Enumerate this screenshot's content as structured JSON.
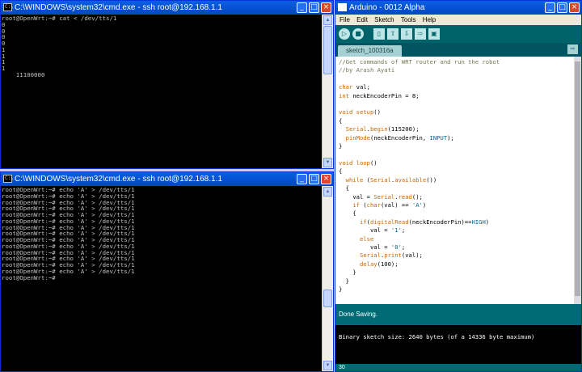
{
  "top_console": {
    "title": "C:\\WINDOWS\\system32\\cmd.exe - ssh root@192.168.1.1",
    "lines": [
      "root@OpenWrt:~# cat < /dev/tts/1",
      "0",
      "0",
      "0",
      "0",
      "1",
      "1",
      "1",
      "1",
      "    11100000"
    ]
  },
  "bottom_console": {
    "title": "C:\\WINDOWS\\system32\\cmd.exe - ssh root@192.168.1.1",
    "lines": [
      "root@OpenWrt:~# echo 'A' > /dev/tts/1",
      "root@OpenWrt:~# echo 'A' > /dev/tts/1",
      "root@OpenWrt:~# echo 'A' > /dev/tts/1",
      "root@OpenWrt:~# echo 'A' > /dev/tts/1",
      "root@OpenWrt:~# echo 'A' > /dev/tts/1",
      "root@OpenWrt:~# echo 'A' > /dev/tts/1",
      "root@OpenWrt:~# echo 'A' > /dev/tts/1",
      "root@OpenWrt:~# echo 'A' > /dev/tts/1",
      "root@OpenWrt:~# echo 'A' > /dev/tts/1",
      "root@OpenWrt:~# echo 'A' > /dev/tts/1",
      "root@OpenWrt:~# echo 'A' > /dev/tts/1",
      "root@OpenWrt:~# echo 'A' > /dev/tts/1",
      "root@OpenWrt:~# echo 'A' > /dev/tts/1",
      "root@OpenWrt:~# echo 'A' > /dev/tts/1",
      "root@OpenWrt:~#"
    ]
  },
  "window_buttons": {
    "minimize": "_",
    "maximize": "□",
    "close": "×"
  },
  "arduino": {
    "title": "Arduino - 0012 Alpha",
    "menu": [
      "File",
      "Edit",
      "Sketch",
      "Tools",
      "Help"
    ],
    "toolbar_icons": [
      "verify-icon",
      "stop-icon",
      "new-icon",
      "open-icon",
      "save-icon",
      "upload-icon",
      "serial-monitor-icon"
    ],
    "tab_label": "sketch_100316a",
    "tab_arrow": "⇨",
    "status": "Done Saving.",
    "output": "Binary sketch size: 2640 bytes (of a 14336 byte maximum)",
    "line_number": "30",
    "code": [
      "//Get commands of WRT router and run the robot",
      "//by Arash Ayati",
      "",
      "char val;",
      "int neckEncoderPin = 8;",
      "",
      "void setup()",
      "{",
      "  Serial.begin(115200);",
      "  pinMode(neckEncoderPin, INPUT);",
      "}",
      "",
      "void loop()",
      "{",
      "  while (Serial.available())",
      "  {",
      "    val = Serial.read();",
      "    if (char(val) == 'A')",
      "    {",
      "      if(digitalRead(neckEncoderPin)==HIGH)",
      "         val = '1';",
      "      else",
      "         val = '0';",
      "      Serial.print(val);",
      "      delay(100);",
      "    }",
      "  }",
      "}"
    ]
  },
  "colors": {
    "titlebar": "#0550d0",
    "arduino_teal": "#006a74",
    "console_bg": "#000000"
  }
}
